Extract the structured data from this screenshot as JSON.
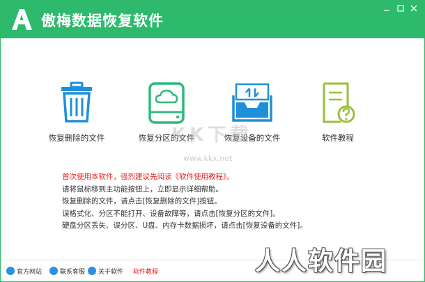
{
  "app": {
    "title": "傲梅数据恢复软件",
    "logo_letter": "A",
    "accent_color": "#2dba6c"
  },
  "window_controls": [
    {
      "name": "minimize",
      "icon": "minimize-icon"
    },
    {
      "name": "maximize",
      "icon": "maximize-icon"
    },
    {
      "name": "close",
      "icon": "close-icon"
    }
  ],
  "features": [
    {
      "label": "恢复删除的文件",
      "icon": "trash-bin-icon",
      "color": "#1e8fd8"
    },
    {
      "label": "恢复分区的文件",
      "icon": "disk-cloud-icon",
      "color": "#2fb87c"
    },
    {
      "label": "恢复设备的文件",
      "icon": "device-tray-icon",
      "color": "#1e8fd8"
    },
    {
      "label": "软件教程",
      "icon": "help-document-icon",
      "color": "#9bbf3a"
    }
  ],
  "watermark": {
    "text": "KK下载",
    "url": "www.kkx.net"
  },
  "info_lines": [
    {
      "text": "首次使用本软件，强烈建议先阅读《软件使用教程》。",
      "highlight": true
    },
    {
      "text": "请将鼠标移到主功能按钮上，立即显示详细帮助。",
      "highlight": false
    },
    {
      "text": "恢复删除的文件，请点击[恢复删除的文件]按钮。",
      "highlight": false
    },
    {
      "text": "误格式化、分区不能打开、设备故障等，请点击[恢复分区的文件]。",
      "highlight": false
    },
    {
      "text": "硬盘分区丢失、误分区、U盘、内存卡数据损坏，请点击[恢复设备的文件]。",
      "highlight": false
    }
  ],
  "footer": {
    "links": [
      {
        "label": "官方网站",
        "icon": "globe-icon"
      },
      {
        "label": "联系客服",
        "icon": "chat-icon"
      },
      {
        "label": "关于软件",
        "icon": "info-icon"
      },
      {
        "label": "软件教程",
        "icon": ""
      }
    ]
  },
  "corner_watermark": "人人软件园"
}
